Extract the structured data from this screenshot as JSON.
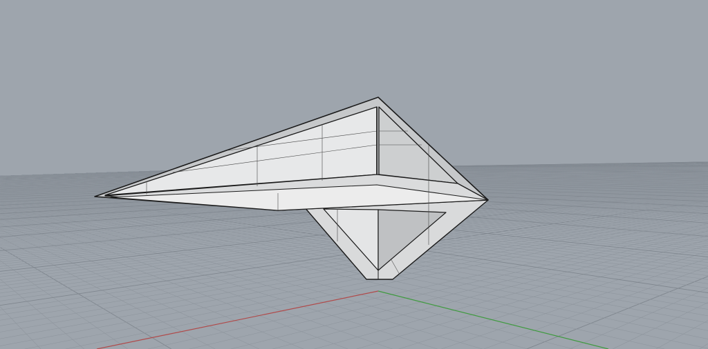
{
  "viewport": {
    "view": "perspective",
    "display_mode": "shaded"
  },
  "colors": {
    "background": "#9ea5ad",
    "grid_minor": "#8f969e",
    "grid_major": "#7f868e",
    "x_axis": "#b04a4a",
    "y_axis": "#3f9a3f",
    "edge": "#1a1a1a"
  },
  "icons": [
    "x-axis-line",
    "y-axis-line",
    "construction-grid"
  ]
}
